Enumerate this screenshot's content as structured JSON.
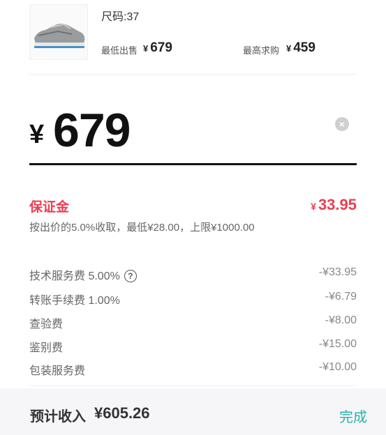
{
  "product": {
    "size_label": "尺码:37",
    "lowest_label": "最低出售",
    "lowest_currency": "¥",
    "lowest_price": "679",
    "highest_label": "最高求购",
    "highest_currency": "¥",
    "highest_price": "459"
  },
  "bid": {
    "currency": "¥",
    "value": "679",
    "clear_icon": "×"
  },
  "deposit": {
    "title": "保证金",
    "currency": "¥",
    "amount": "33.95",
    "description": "按出价的5.0%收取，最低¥28.00，上限¥1000.00"
  },
  "fees": [
    {
      "label": "技术服务费 5.00%",
      "value": "-¥33.95",
      "help_icon": "?"
    },
    {
      "label": "转账手续费 1.00%",
      "value": "-¥6.79"
    },
    {
      "label": "查验费",
      "value": "-¥8.00"
    },
    {
      "label": "鉴别费",
      "value": "-¥15.00"
    },
    {
      "label": "包装服务费",
      "value": "-¥10.00"
    }
  ],
  "footer": {
    "estimate_label": "预计收入",
    "estimate_value": "¥605.26",
    "done_label": "完成"
  },
  "colors": {
    "accent_red": "#ee3d50",
    "accent_teal": "#1fb5ab"
  }
}
